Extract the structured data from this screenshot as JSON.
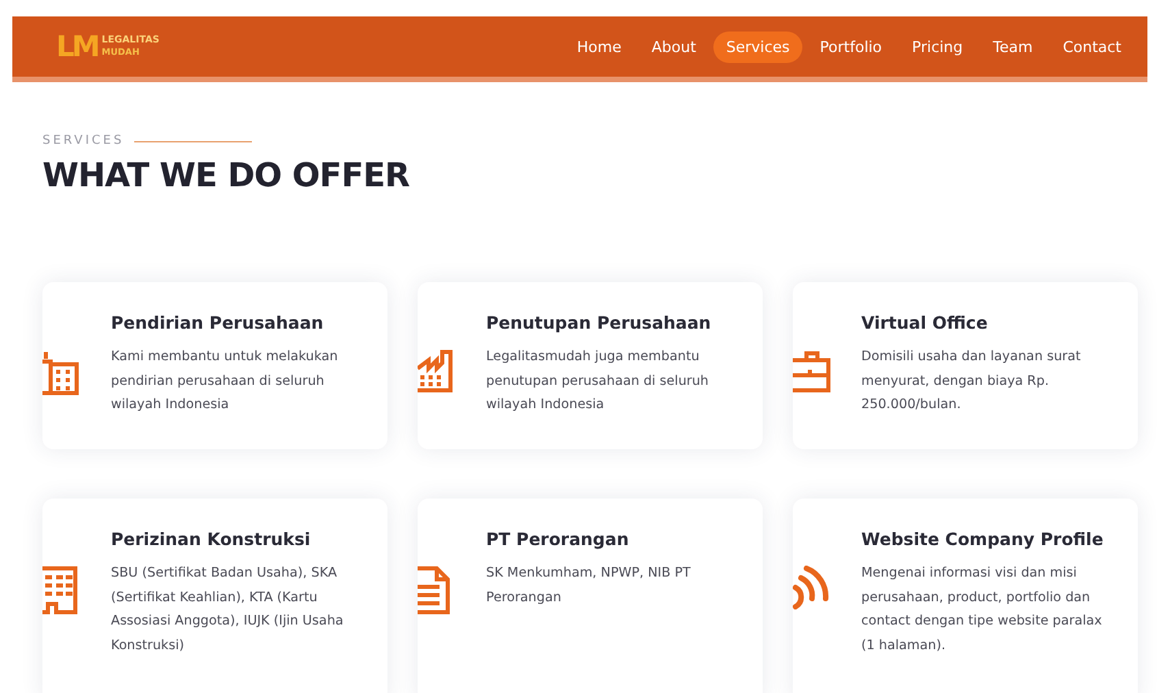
{
  "header": {
    "logo": {
      "mark": "LM",
      "line_1": "LEGALITAS",
      "line_2": "MUDAH"
    },
    "nav": [
      {
        "label": "Home",
        "selected": false
      },
      {
        "label": "About",
        "selected": false
      },
      {
        "label": "Services",
        "selected": true
      },
      {
        "label": "Portfolio",
        "selected": false
      },
      {
        "label": "Pricing",
        "selected": false
      },
      {
        "label": "Team",
        "selected": false
      },
      {
        "label": "Contact",
        "selected": false
      }
    ]
  },
  "section": {
    "eyebrow": "SERVICES",
    "title": "WHAT WE DO OFFER"
  },
  "services": [
    {
      "kind": "building",
      "title": "Pendirian Perusahaan",
      "text": "Kami membantu untuk melakukan pendirian perusahaan di seluruh wilayah Indonesia"
    },
    {
      "kind": "factory",
      "title": "Penutupan Perusahaan",
      "text": "Legalitasmudah juga membantu penutupan perusahaan di seluruh wilayah Indonesia"
    },
    {
      "kind": "briefcase",
      "title": "Virtual Office",
      "text": "Domisili usaha dan layanan surat menyurat, dengan biaya Rp. 250.000/bulan."
    },
    {
      "kind": "office",
      "title": "Perizinan Konstruksi",
      "text": "SBU (Sertifikat Badan Usaha), SKA (Sertifikat Keahlian), KTA (Kartu Assosiasi Anggota), IUJK (Ijin Usaha Konstruksi)"
    },
    {
      "kind": "document",
      "title": "PT Perorangan",
      "text": "SK Menkumham, NPWP, NIB PT Perorangan"
    },
    {
      "kind": "rss",
      "title": "Website Company Profile",
      "text": "Mengenai informasi visi dan misi perusahaan, product, portfolio dan contact dengan tipe website paralax (1 halaman)."
    }
  ]
}
